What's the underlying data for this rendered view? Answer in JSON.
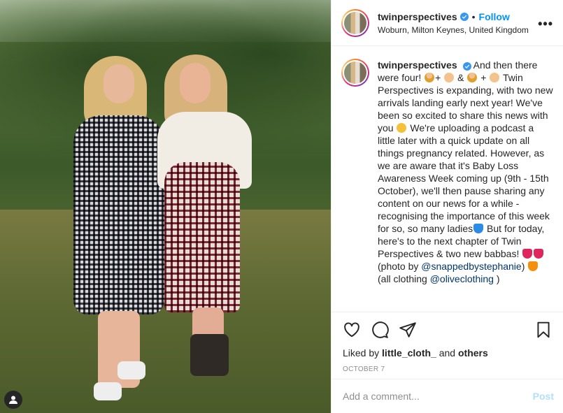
{
  "post": {
    "username": "twinperspectives",
    "follow_label": "Follow",
    "location": "Woburn, Milton Keynes, United Kingdom",
    "more_label": "•••",
    "caption": {
      "username": "twinperspectives",
      "part1": "And then there were four! ",
      "part2": "+ ",
      "part3": " & ",
      "part4": " + ",
      "part5": " Twin Perspectives is expanding, with two new arrivals landing early next year! We've been so excited to share this news with you ",
      "part6": " We're uploading a podcast a little later with a quick update on all things pregnancy related. However, as we are aware that it's Baby Loss Awareness Week coming up (9th - 15th October), we'll then pause sharing any content on our news for a while - recognising the importance of this week for so, so many ladies",
      "part7": " But for today, here's to the next chapter of Twin Perspectives & two new babbas! ",
      "part8": " (photo by ",
      "mention1": "@snappedbystephanie",
      "part9": ") ",
      "part10": " (all clothing ",
      "mention2": "@oliveclothing",
      "part11": " )"
    },
    "liked_prefix": "Liked by ",
    "liked_user": "little_cloth_",
    "liked_mid": " and ",
    "liked_others": "others",
    "date": "OCTOBER 7",
    "comment_placeholder": "Add a comment...",
    "post_label": "Post"
  },
  "icons": {
    "like": "heart-icon",
    "comment": "comment-icon",
    "share": "paper-plane-icon",
    "save": "bookmark-icon",
    "tag": "user-tag-icon",
    "verified": "verified-badge-icon"
  },
  "colors": {
    "accent": "#0095f6",
    "verified": "#3897f0",
    "muted": "#8e8e8e",
    "link": "#00376b",
    "post_disabled": "#b2dffc"
  }
}
